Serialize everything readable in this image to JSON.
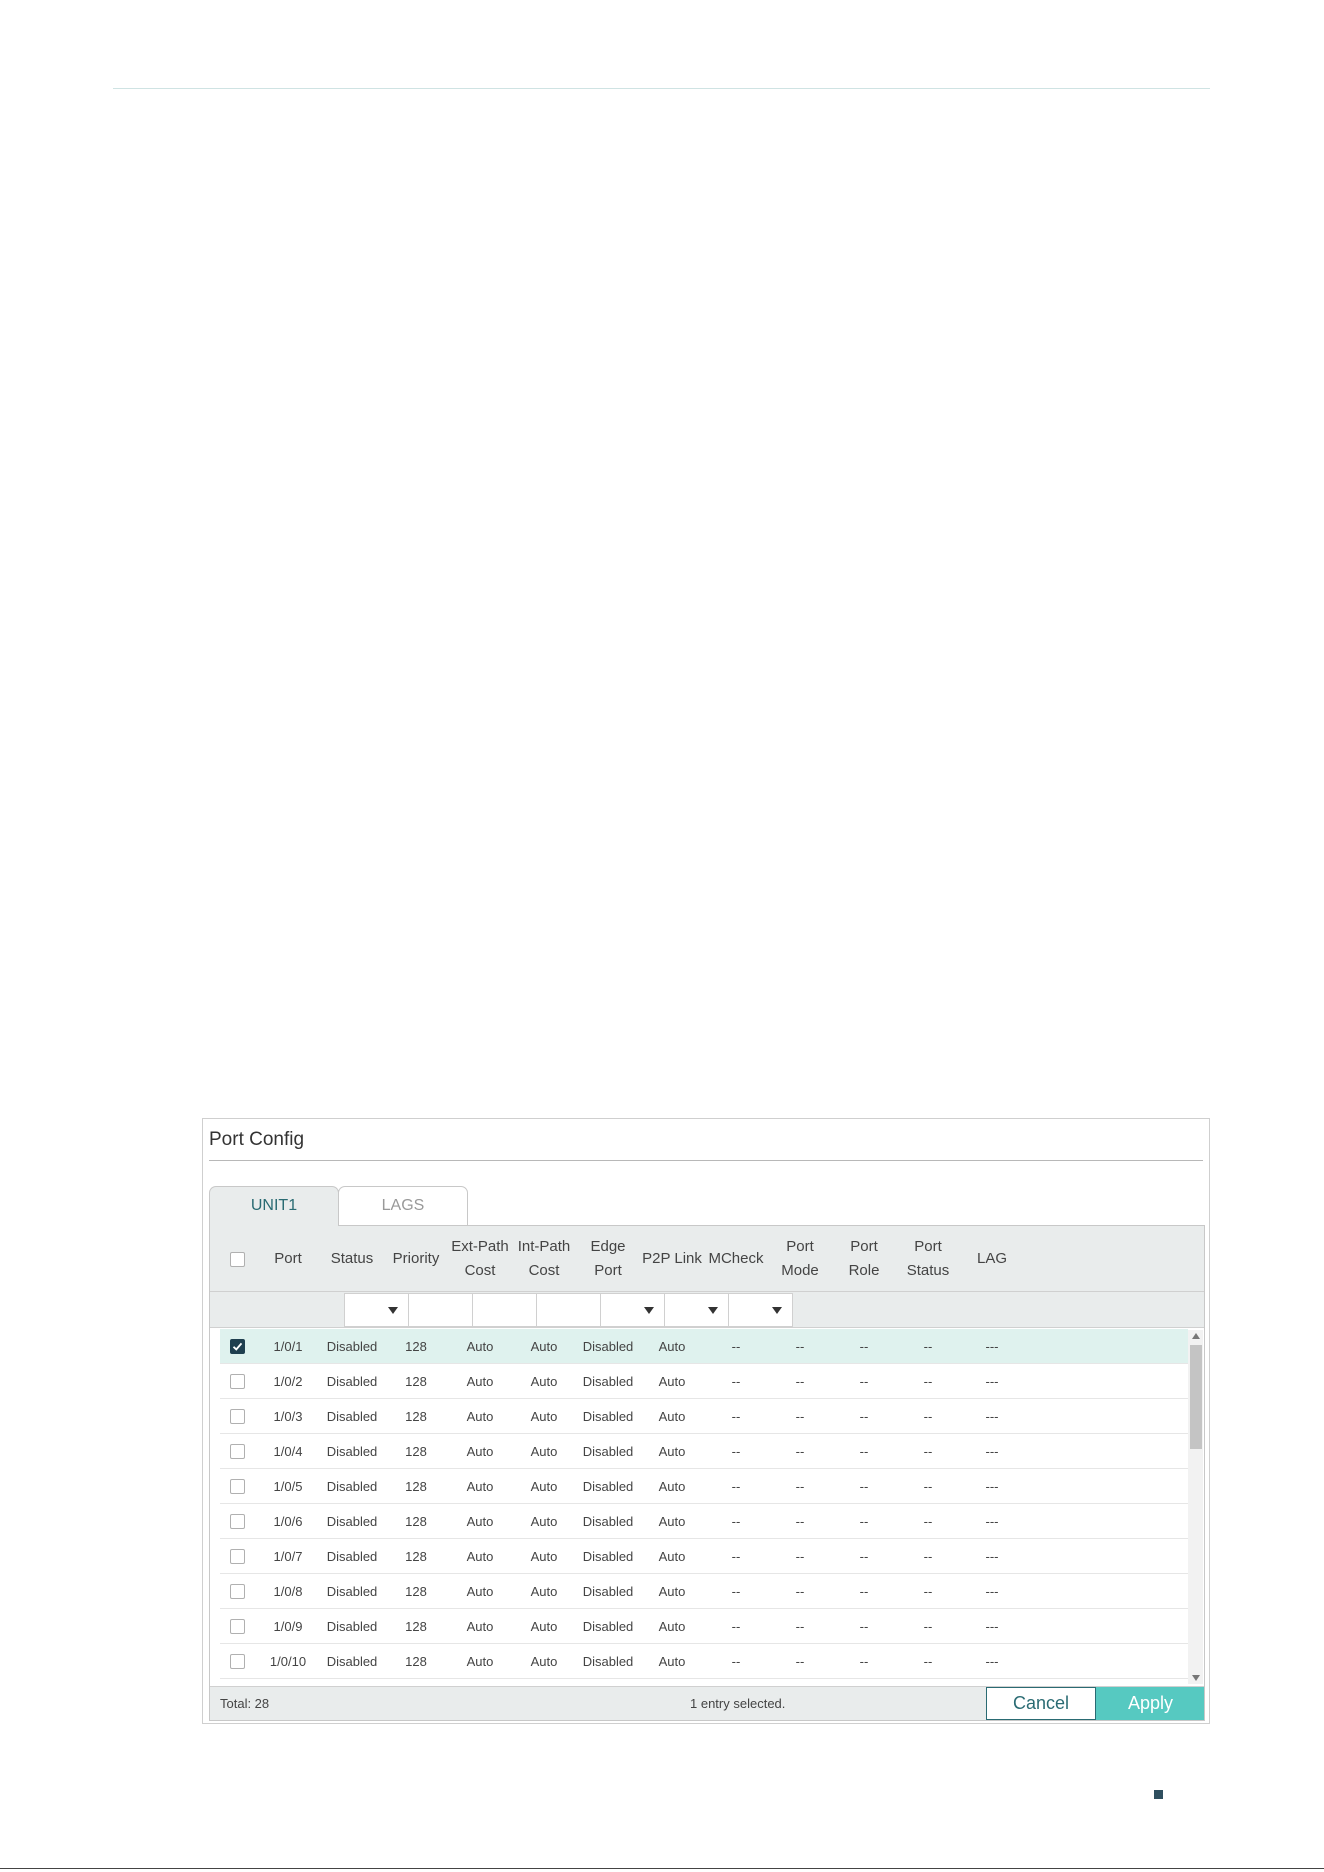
{
  "panel": {
    "title": "Port Config",
    "tabs": [
      "UNIT1",
      "LAGS"
    ]
  },
  "columns": [
    {
      "key": "port",
      "label": "Port"
    },
    {
      "key": "status",
      "label": "Status"
    },
    {
      "key": "priority",
      "label": "Priority"
    },
    {
      "key": "ext_path_cost",
      "label": "Ext-Path\nCost"
    },
    {
      "key": "int_path_cost",
      "label": "Int-Path\nCost"
    },
    {
      "key": "edge_port",
      "label": "Edge\nPort"
    },
    {
      "key": "p2p_link",
      "label": "P2P Link"
    },
    {
      "key": "mcheck",
      "label": "MCheck"
    },
    {
      "key": "port_mode",
      "label": "Port\nMode"
    },
    {
      "key": "port_role",
      "label": "Port\nRole"
    },
    {
      "key": "port_status",
      "label": "Port\nStatus"
    },
    {
      "key": "lag",
      "label": "LAG"
    }
  ],
  "rows": [
    {
      "checked": true,
      "cells": [
        "1/0/1",
        "Disabled",
        "128",
        "Auto",
        "Auto",
        "Disabled",
        "Auto",
        "--",
        "--",
        "--",
        "--",
        "---"
      ]
    },
    {
      "checked": false,
      "cells": [
        "1/0/2",
        "Disabled",
        "128",
        "Auto",
        "Auto",
        "Disabled",
        "Auto",
        "--",
        "--",
        "--",
        "--",
        "---"
      ]
    },
    {
      "checked": false,
      "cells": [
        "1/0/3",
        "Disabled",
        "128",
        "Auto",
        "Auto",
        "Disabled",
        "Auto",
        "--",
        "--",
        "--",
        "--",
        "---"
      ]
    },
    {
      "checked": false,
      "cells": [
        "1/0/4",
        "Disabled",
        "128",
        "Auto",
        "Auto",
        "Disabled",
        "Auto",
        "--",
        "--",
        "--",
        "--",
        "---"
      ]
    },
    {
      "checked": false,
      "cells": [
        "1/0/5",
        "Disabled",
        "128",
        "Auto",
        "Auto",
        "Disabled",
        "Auto",
        "--",
        "--",
        "--",
        "--",
        "---"
      ]
    },
    {
      "checked": false,
      "cells": [
        "1/0/6",
        "Disabled",
        "128",
        "Auto",
        "Auto",
        "Disabled",
        "Auto",
        "--",
        "--",
        "--",
        "--",
        "---"
      ]
    },
    {
      "checked": false,
      "cells": [
        "1/0/7",
        "Disabled",
        "128",
        "Auto",
        "Auto",
        "Disabled",
        "Auto",
        "--",
        "--",
        "--",
        "--",
        "---"
      ]
    },
    {
      "checked": false,
      "cells": [
        "1/0/8",
        "Disabled",
        "128",
        "Auto",
        "Auto",
        "Disabled",
        "Auto",
        "--",
        "--",
        "--",
        "--",
        "---"
      ]
    },
    {
      "checked": false,
      "cells": [
        "1/0/9",
        "Disabled",
        "128",
        "Auto",
        "Auto",
        "Disabled",
        "Auto",
        "--",
        "--",
        "--",
        "--",
        "---"
      ]
    },
    {
      "checked": false,
      "cells": [
        "1/0/10",
        "Disabled",
        "128",
        "Auto",
        "Auto",
        "Disabled",
        "Auto",
        "--",
        "--",
        "--",
        "--",
        "---"
      ]
    }
  ],
  "footer": {
    "total": "Total: 28",
    "selected": "1 entry selected.",
    "cancel_label": "Cancel",
    "apply_label": "Apply"
  },
  "colors": {
    "accent": "#56c9c1",
    "selected_row": "#dff2ee",
    "header_bg": "#e9ecec",
    "tab_active_text": "#2a6b73"
  }
}
